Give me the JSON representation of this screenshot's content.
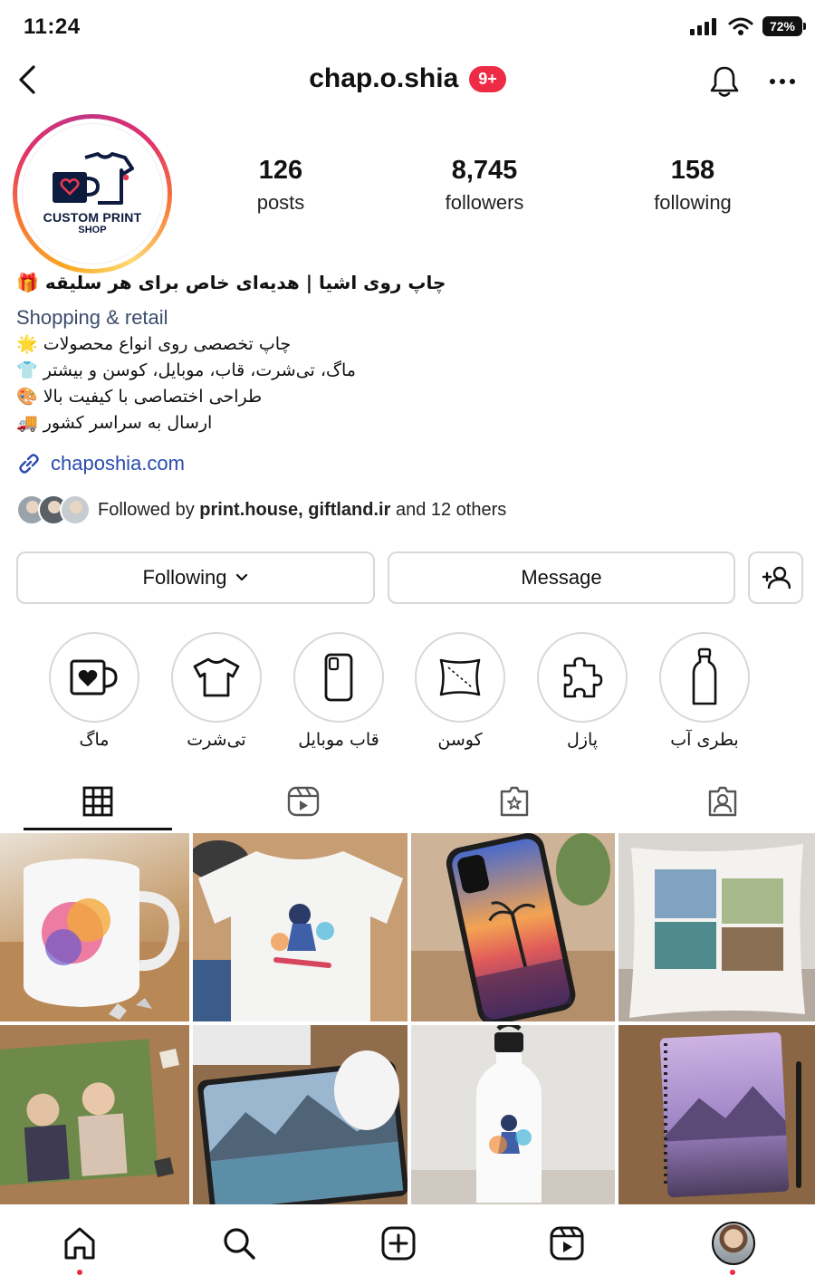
{
  "status_bar": {
    "time": "11:24",
    "battery": "72%"
  },
  "header": {
    "username": "chap.o.shia",
    "notifications": "9+"
  },
  "profile": {
    "logo_line1": "CUSTOM PRINT",
    "logo_line2": "SHOP",
    "stats": [
      {
        "value": "126",
        "label": "posts"
      },
      {
        "value": "8,745",
        "label": "followers"
      },
      {
        "value": "158",
        "label": "following"
      }
    ]
  },
  "bio": {
    "title": "چاپ روی اشیا | هدیه‌ای خاص برای هر سلیقه 🎁",
    "category": "Shopping & retail",
    "lines": [
      "چاپ تخصصی روی انواع محصولات 🌟",
      "ماگ، تی‌شرت، قاب، موبایل، کوسن و بیشتر 👕",
      "طراحی اختصاصی با کیفیت بالا 🎨",
      "ارسال به سراسر کشور 🚚"
    ],
    "link": "chaposhia.com"
  },
  "followed_by": {
    "prefix": "Followed by",
    "names": "print.house, giftland.ir",
    "suffix": "and 12 others"
  },
  "actions": {
    "following": "Following",
    "message": "Message"
  },
  "highlights": [
    {
      "label": "ماگ",
      "icon": "mug-heart-icon"
    },
    {
      "label": "تی‌شرت",
      "icon": "tshirt-icon"
    },
    {
      "label": "قاب موبایل",
      "icon": "phone-case-icon"
    },
    {
      "label": "کوسن",
      "icon": "cushion-icon"
    },
    {
      "label": "پازل",
      "icon": "puzzle-icon"
    },
    {
      "label": "بطری آب",
      "icon": "water-bottle-icon"
    }
  ],
  "tabs": [
    "grid-icon",
    "reels-icon",
    "collab-icon",
    "tagged-icon"
  ],
  "grid_posts": [
    "mug-print-post",
    "tshirt-print-post",
    "phone-case-post",
    "cushion-print-post",
    "puzzle-print-post",
    "mousepad-print-post",
    "bottle-print-post",
    "notebook-print-post"
  ],
  "bottom_nav": [
    "home-icon",
    "search-icon",
    "create-icon",
    "reels-icon",
    "profile-avatar"
  ]
}
